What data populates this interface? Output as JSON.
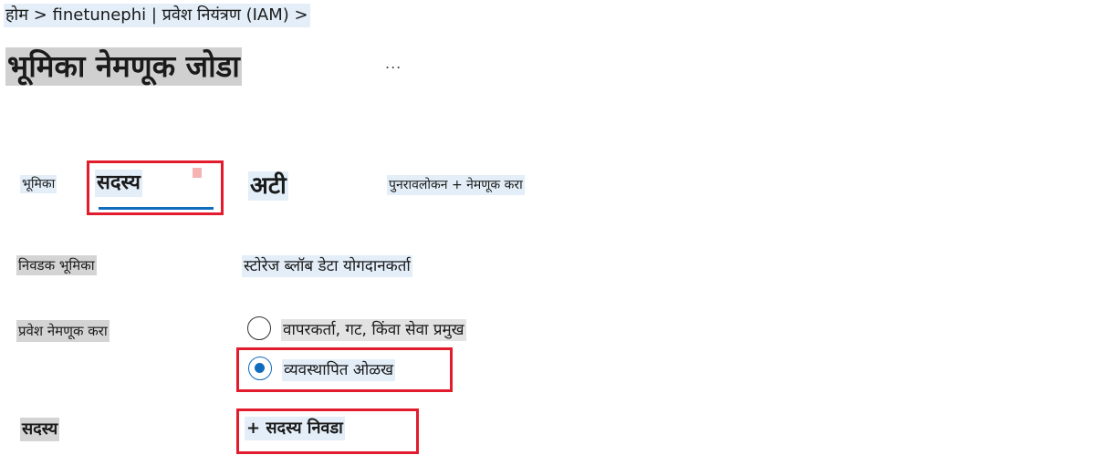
{
  "breadcrumb": {
    "text": "होम > finetunephi | प्रवेश नियंत्रण (IAM) >"
  },
  "page": {
    "title": "भूमिका नेमणूक जोडा",
    "more_label": "..."
  },
  "tabs": [
    {
      "label": "भूमिका"
    },
    {
      "label": "सदस्य"
    },
    {
      "label": "अटी"
    },
    {
      "label": "पुनरावलोकन + नेमणूक करा"
    }
  ],
  "form": {
    "selected_role_label": "निवडक भूमिका",
    "selected_role_value": "स्टोरेज ब्लॉब डेटा योगदानकर्ता",
    "assign_access_label": "प्रवेश नेमणूक करा",
    "assign_options": [
      {
        "label": "वापरकर्ता, गट, किंवा सेवा प्रमुख",
        "selected": false
      },
      {
        "label": "व्यवस्थापित ओळख",
        "selected": true
      }
    ],
    "members_label": "सदस्य",
    "add_members_label": "+ सदस्य निवडा"
  },
  "colors": {
    "accent": "#0f6cbd",
    "highlight_box": "#e21b2d"
  }
}
